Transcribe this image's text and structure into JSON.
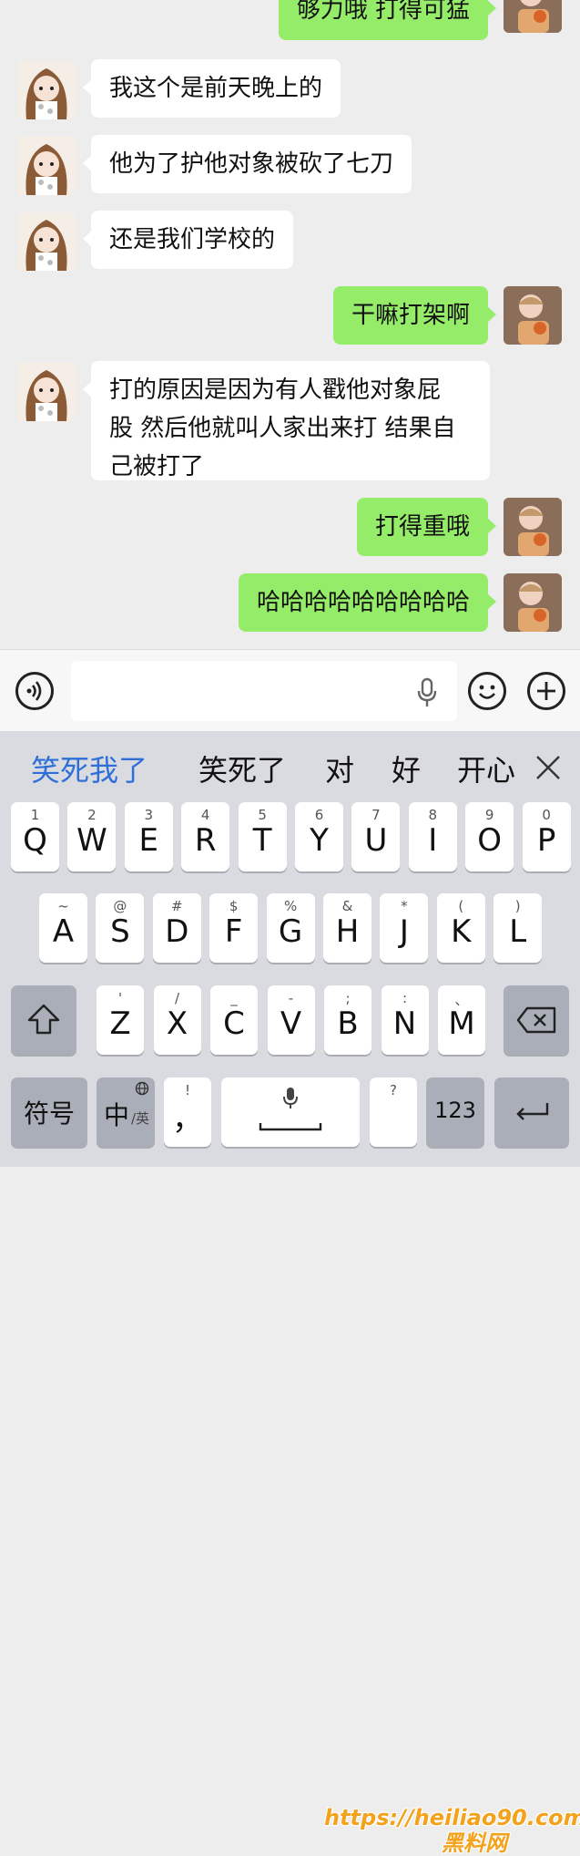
{
  "messages": [
    {
      "side": "out",
      "text": "够力哦 打得可猛"
    },
    {
      "side": "in",
      "text": "我这个是前天晚上的"
    },
    {
      "side": "in",
      "text": "他为了护他对象被砍了七刀"
    },
    {
      "side": "in",
      "text": "还是我们学校的"
    },
    {
      "side": "out",
      "text": "干嘛打架啊"
    },
    {
      "side": "in",
      "lines": [
        "打的原因是因为有人戳他对象屁",
        "股 然后他就叫人家出来打 结果自",
        "己被打了"
      ]
    },
    {
      "side": "out",
      "text": "打得重哦"
    },
    {
      "side": "out",
      "text": "哈哈哈哈哈哈哈哈哈"
    }
  ],
  "input_bar": {
    "voice_icon": "voice-icon",
    "mic_icon": "microphone-icon",
    "emoji_icon": "emoji-icon",
    "plus_icon": "plus-icon",
    "value": ""
  },
  "keyboard": {
    "suggestions": [
      "笑死我了",
      "笑死了",
      "对",
      "好",
      "开心"
    ],
    "close_icon": "close-icon",
    "row1": [
      {
        "sub": "1",
        "key": "Q"
      },
      {
        "sub": "2",
        "key": "W"
      },
      {
        "sub": "3",
        "key": "E"
      },
      {
        "sub": "4",
        "key": "R"
      },
      {
        "sub": "5",
        "key": "T"
      },
      {
        "sub": "6",
        "key": "Y"
      },
      {
        "sub": "7",
        "key": "U"
      },
      {
        "sub": "8",
        "key": "I"
      },
      {
        "sub": "9",
        "key": "O"
      },
      {
        "sub": "0",
        "key": "P"
      }
    ],
    "row2": [
      {
        "sub": "~",
        "key": "A"
      },
      {
        "sub": "@",
        "key": "S"
      },
      {
        "sub": "#",
        "key": "D"
      },
      {
        "sub": "$",
        "key": "F"
      },
      {
        "sub": "%",
        "key": "G"
      },
      {
        "sub": "&",
        "key": "H"
      },
      {
        "sub": "*",
        "key": "J"
      },
      {
        "sub": "(",
        "key": "K"
      },
      {
        "sub": ")",
        "key": "L"
      }
    ],
    "row3": [
      {
        "sub": "'",
        "key": "Z"
      },
      {
        "sub": "/",
        "key": "X"
      },
      {
        "sub": "_",
        "key": "C"
      },
      {
        "sub": "-",
        "key": "V"
      },
      {
        "sub": ";",
        "key": "B"
      },
      {
        "sub": ":",
        "key": "N"
      },
      {
        "sub": "、",
        "key": "M"
      }
    ],
    "symbols_label": "符号",
    "lang_label": "中",
    "lang_sub": "/英",
    "comma_sub": "!",
    "comma": "，",
    "period_sub": "?",
    "num_label": "123",
    "shift_icon": "shift-icon",
    "backspace_icon": "backspace-icon",
    "enter_icon": "enter-icon",
    "globe_icon": "globe-icon"
  },
  "watermark": {
    "line1": "https://heiliao90.com",
    "line2": "黑料网"
  },
  "colors": {
    "out_bubble": "#95ec69",
    "in_bubble": "#ffffff",
    "chat_bg": "#ededed",
    "suggest_highlight": "#2f6fd8"
  }
}
